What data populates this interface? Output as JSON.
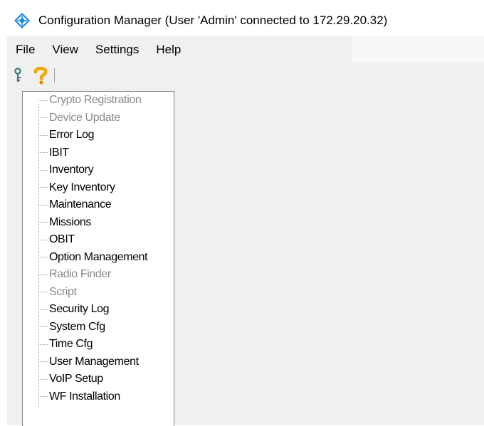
{
  "window": {
    "title": "Configuration Manager (User 'Admin' connected to 172.29.20.32)",
    "app_icon": "diamond-network-icon",
    "accent_color": "#1e88e5"
  },
  "menu": [
    "File",
    "View",
    "Settings",
    "Help"
  ],
  "toolbar": {
    "buttons": [
      {
        "icon": "key-icon"
      },
      {
        "icon": "help-question-icon"
      }
    ]
  },
  "tree": {
    "items": [
      {
        "label": "Crypto Registration",
        "enabled": false
      },
      {
        "label": "Device Update",
        "enabled": false
      },
      {
        "label": "Error Log",
        "enabled": true
      },
      {
        "label": "IBIT",
        "enabled": true
      },
      {
        "label": "Inventory",
        "enabled": true
      },
      {
        "label": "Key Inventory",
        "enabled": true
      },
      {
        "label": "Maintenance",
        "enabled": true
      },
      {
        "label": "Missions",
        "enabled": true
      },
      {
        "label": "OBIT",
        "enabled": true
      },
      {
        "label": "Option Management",
        "enabled": true
      },
      {
        "label": "Radio Finder",
        "enabled": false
      },
      {
        "label": "Script",
        "enabled": false
      },
      {
        "label": "Security Log",
        "enabled": true
      },
      {
        "label": "System Cfg",
        "enabled": true
      },
      {
        "label": "Time Cfg",
        "enabled": true
      },
      {
        "label": "User Management",
        "enabled": true
      },
      {
        "label": "VoIP Setup",
        "enabled": true
      },
      {
        "label": "WF Installation",
        "enabled": true
      }
    ]
  }
}
